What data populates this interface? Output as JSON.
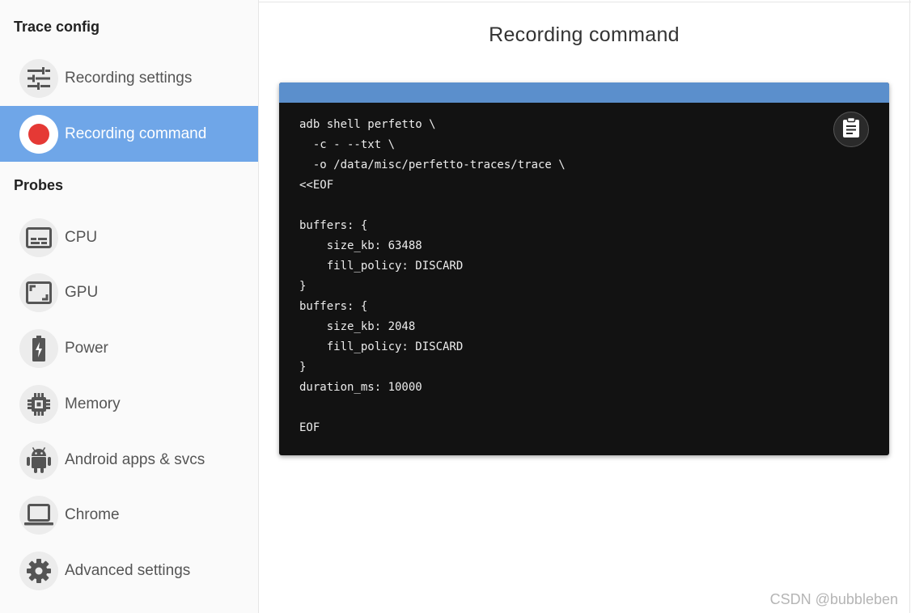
{
  "sidebar": {
    "trace_config_title": "Trace config",
    "probes_title": "Probes",
    "config_items": [
      {
        "label": "Recording settings",
        "icon": "tune-icon"
      },
      {
        "label": "Recording command",
        "icon": "record-icon",
        "active": true
      }
    ],
    "probe_items": [
      {
        "label": "CPU",
        "icon": "cpu-icon"
      },
      {
        "label": "GPU",
        "icon": "gpu-icon"
      },
      {
        "label": "Power",
        "icon": "battery-icon"
      },
      {
        "label": "Memory",
        "icon": "memory-chip-icon"
      },
      {
        "label": "Android apps & svcs",
        "icon": "android-icon"
      },
      {
        "label": "Chrome",
        "icon": "laptop-icon"
      },
      {
        "label": "Advanced settings",
        "icon": "gear-icon"
      }
    ]
  },
  "main": {
    "title": "Recording command",
    "command": "adb shell perfetto \\\n  -c - --txt \\\n  -o /data/misc/perfetto-traces/trace \\\n<<EOF\n\nbuffers: {\n    size_kb: 63488\n    fill_policy: DISCARD\n}\nbuffers: {\n    size_kb: 2048\n    fill_policy: DISCARD\n}\nduration_ms: 10000\n\nEOF",
    "copy_icon": "clipboard-icon"
  },
  "watermark": "CSDN @bubbleben",
  "colors": {
    "active_bg": "#6fa6e8",
    "code_header": "#5b8fcc",
    "code_bg": "#121212",
    "record_dot": "#e53935"
  }
}
